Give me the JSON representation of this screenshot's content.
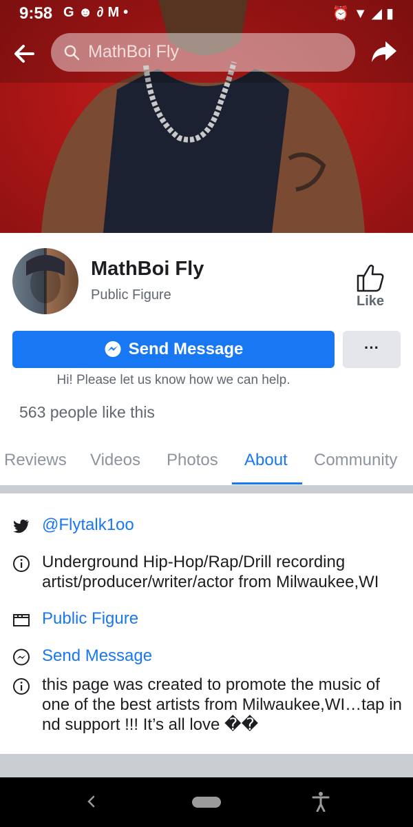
{
  "status_bar": {
    "time": "9:58",
    "notification_icons": [
      "google-icon",
      "reddit-icon",
      "link-icon",
      "gmail-icon",
      "dot-icon"
    ],
    "system_icons": [
      "alarm-icon",
      "wifi-icon",
      "signal-icon",
      "battery-icon"
    ]
  },
  "top_bar": {
    "search_text": "MathBoi Fly"
  },
  "profile": {
    "name": "MathBoi Fly",
    "category": "Public Figure",
    "like_label": "Like"
  },
  "actions": {
    "send_message_label": "Send Message",
    "more_label": "···",
    "help_text": "Hi! Please let us know how we can help."
  },
  "likes_count_text": "563 people like this",
  "tabs": [
    {
      "label": "Reviews",
      "active": false
    },
    {
      "label": "Videos",
      "active": false
    },
    {
      "label": "Photos",
      "active": false
    },
    {
      "label": "About",
      "active": true
    },
    {
      "label": "Community",
      "active": false
    }
  ],
  "about": {
    "twitter": "@Flytalk1oo",
    "bio": "Underground Hip-Hop/Rap/Drill recording artist/producer/writer/actor from Milwaukee,WI",
    "category": "Public Figure",
    "send_message": "Send Message",
    "description": "this page was created to promote the music of one of the best artists from Milwaukee,WI…tap in nd support !!! It’s all love ��"
  },
  "colors": {
    "accent": "#1877f2",
    "cover_red": "#b31717",
    "separator": "#c9ccd1"
  }
}
